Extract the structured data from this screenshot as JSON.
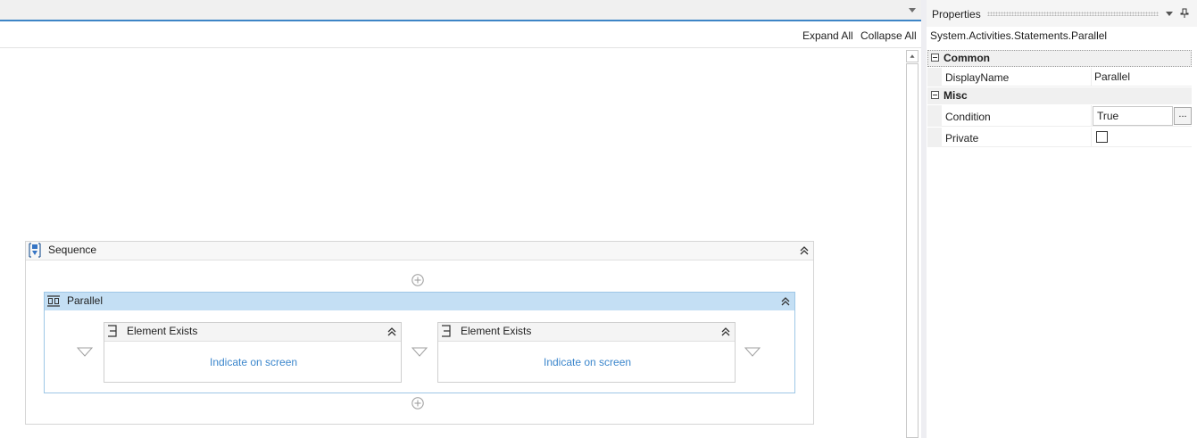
{
  "designer": {
    "toolbar": {
      "expand_all": "Expand All",
      "collapse_all": "Collapse All"
    },
    "sequence": {
      "title": "Sequence",
      "parallel": {
        "title": "Parallel",
        "activities": [
          {
            "title": "Element Exists",
            "link": "Indicate on screen"
          },
          {
            "title": "Element Exists",
            "link": "Indicate on screen"
          }
        ]
      }
    }
  },
  "properties": {
    "panel_title": "Properties",
    "selected_type": "System.Activities.Statements.Parallel",
    "categories": [
      {
        "name": "Common",
        "rows": [
          {
            "name": "DisplayName",
            "value": "Parallel"
          }
        ]
      },
      {
        "name": "Misc",
        "rows": [
          {
            "name": "Condition",
            "value": "True",
            "button": "..."
          },
          {
            "name": "Private",
            "checked": false
          }
        ]
      }
    ]
  },
  "colors": {
    "accent_tab_line": "#3d85c6",
    "parallel_header": "#c4dff4",
    "link": "#3b86cc"
  },
  "icons": {
    "tab_dropdown": "chevron-down-icon",
    "sequence": "sequence-icon",
    "parallel": "parallel-icon",
    "element_exists": "element-exists-icon",
    "collapse": "double-chevron-up-icon",
    "add": "plus-circle-icon",
    "drop": "drop-triangle-icon",
    "panel_menu": "chevron-down-icon",
    "pin": "pin-icon"
  }
}
